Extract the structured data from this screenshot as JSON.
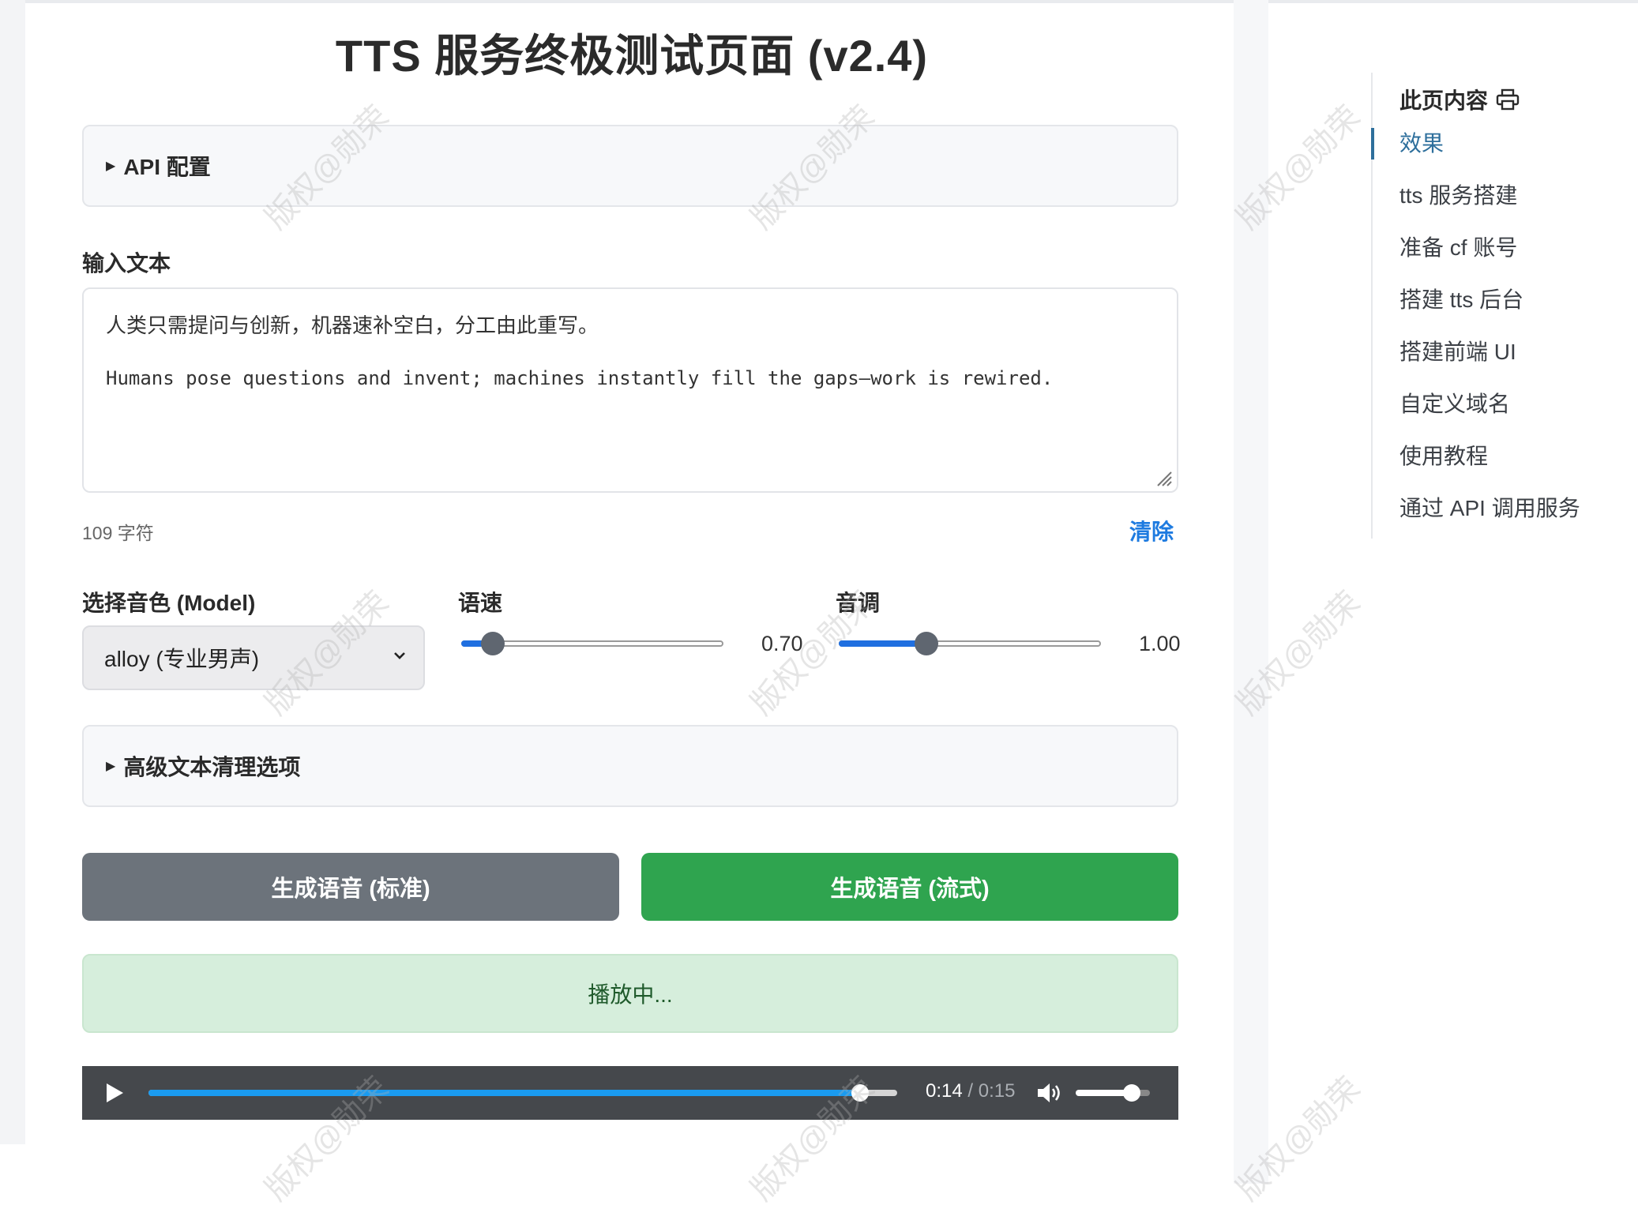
{
  "page": {
    "title": "TTS 服务终极测试页面 (v2.4)",
    "accent_color": "#1e7be0"
  },
  "api_panel": {
    "label": "API 配置"
  },
  "input": {
    "label": "输入文本",
    "value_line1": "人类只需提问与创新，机器速补空白，分工由此重写。",
    "value_line2": "Humans pose questions and invent; machines instantly fill the gaps—work is rewired.",
    "char_count": "109 字符",
    "clear_label": "清除"
  },
  "voice": {
    "label": "选择音色 (Model)",
    "selected": "alloy (专业男声)"
  },
  "speed": {
    "label": "语速",
    "value": 0.7,
    "display": "0.70",
    "min": 0.25,
    "max": 4.0
  },
  "pitch": {
    "label": "音调",
    "value": 1.0,
    "display": "1.00",
    "min": 0.5,
    "max": 2.0
  },
  "advanced_panel": {
    "label": "高级文本清理选项"
  },
  "buttons": {
    "standard": "生成语音 (标准)",
    "stream": "生成语音 (流式)",
    "standard_color": "#6c737b",
    "stream_color": "#2fa44f"
  },
  "status": {
    "text": "播放中...",
    "color": "#d6eedc"
  },
  "player": {
    "current": "0:14",
    "separator": " / ",
    "duration": "0:15",
    "progress_fraction": 0.95,
    "volume_fraction": 0.75
  },
  "toc": {
    "title": "此页内容",
    "items": [
      {
        "label": "效果",
        "active": true
      },
      {
        "label": "tts 服务搭建",
        "active": false
      },
      {
        "label": "准备 cf 账号",
        "active": false
      },
      {
        "label": "搭建 tts 后台",
        "active": false
      },
      {
        "label": "搭建前端 UI",
        "active": false
      },
      {
        "label": "自定义域名",
        "active": false
      },
      {
        "label": "使用教程",
        "active": false
      },
      {
        "label": "通过 API 调用服务",
        "active": false
      }
    ]
  },
  "watermark": {
    "text": "版权@勋荣"
  }
}
